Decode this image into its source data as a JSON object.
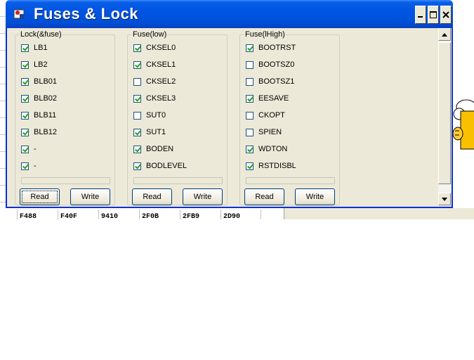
{
  "window": {
    "title": "Fuses & Lock"
  },
  "groups": [
    {
      "title": "Lock(&fuse)",
      "items": [
        {
          "label": "LB1",
          "checked": true
        },
        {
          "label": "LB2",
          "checked": true
        },
        {
          "label": "BLB01",
          "checked": true
        },
        {
          "label": "BLB02",
          "checked": true
        },
        {
          "label": "BLB11",
          "checked": true
        },
        {
          "label": "BLB12",
          "checked": true
        },
        {
          "label": "-",
          "checked": true
        },
        {
          "label": "-",
          "checked": true
        }
      ],
      "read_label": "Read",
      "write_label": "Write"
    },
    {
      "title": "Fuse(low)",
      "items": [
        {
          "label": "CKSEL0",
          "checked": true
        },
        {
          "label": "CKSEL1",
          "checked": true
        },
        {
          "label": "CKSEL2",
          "checked": false
        },
        {
          "label": "CKSEL3",
          "checked": true
        },
        {
          "label": "SUT0",
          "checked": false
        },
        {
          "label": "SUT1",
          "checked": true
        },
        {
          "label": "BODEN",
          "checked": true
        },
        {
          "label": "BODLEVEL",
          "checked": true
        }
      ],
      "read_label": "Read",
      "write_label": "Write"
    },
    {
      "title": "Fuse(lHigh)",
      "items": [
        {
          "label": "BOOTRST",
          "checked": true
        },
        {
          "label": "BOOTSZ0",
          "checked": false
        },
        {
          "label": "BOOTSZ1",
          "checked": false
        },
        {
          "label": "EESAVE",
          "checked": true
        },
        {
          "label": "CKOPT",
          "checked": false
        },
        {
          "label": "SPIEN",
          "checked": false
        },
        {
          "label": "WDTON",
          "checked": true
        },
        {
          "label": "RSTDISBL",
          "checked": true
        }
      ],
      "read_label": "Read",
      "write_label": "Write"
    }
  ],
  "background_table": [
    "F488",
    "F40F",
    "9410",
    "2F0B",
    "2FB9",
    "2D90"
  ],
  "colors": {
    "titlebar": "#0054e3",
    "window_bg": "#ece9d8",
    "check": "#21a121"
  }
}
